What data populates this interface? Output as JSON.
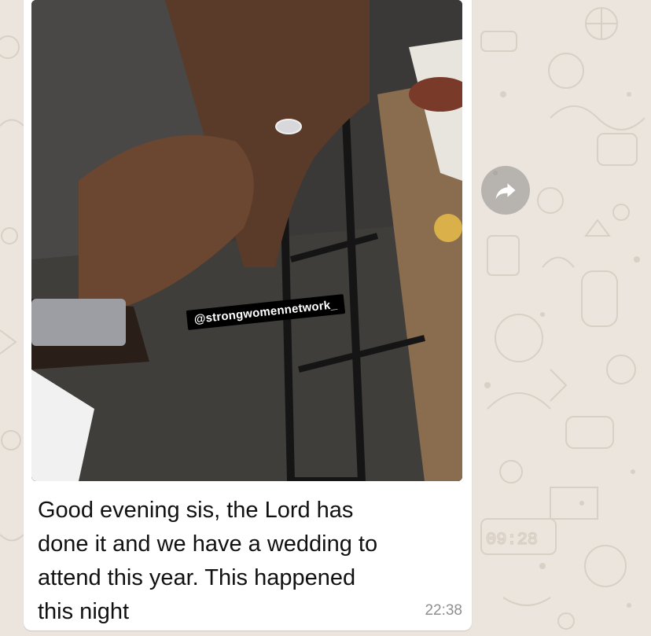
{
  "photo": {
    "watermark": "@strongwomennetwork_"
  },
  "message": {
    "text": "Good evening sis, the Lord has\ndone it and we have a wedding to\nattend this year. This happened\nthis night",
    "time": "22:38"
  },
  "icons": {
    "forward": "forward-arrow-icon"
  },
  "colors": {
    "wallpaper": "#ece5dd",
    "bubble": "#ffffff",
    "timestamp": "#8f8f8f"
  }
}
